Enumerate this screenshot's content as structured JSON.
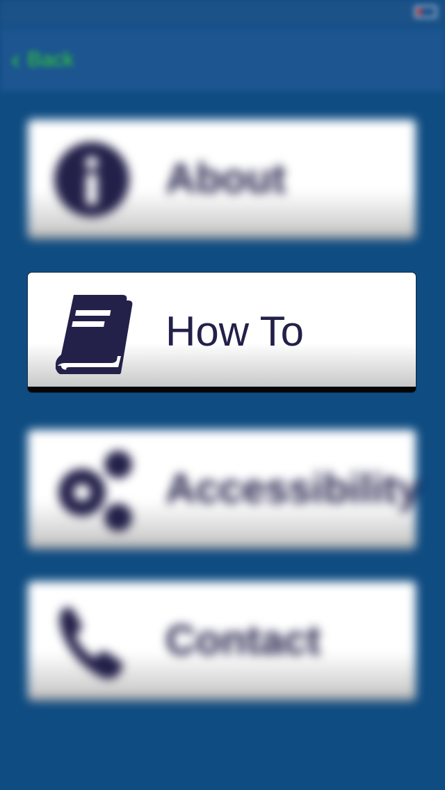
{
  "status_bar": {
    "carrier": "",
    "time": "",
    "battery": ""
  },
  "nav": {
    "back_label": "Back"
  },
  "menu": {
    "items": [
      {
        "label": "About",
        "icon": "info-icon"
      },
      {
        "label": "How To",
        "icon": "book-icon"
      },
      {
        "label": "Accessibility",
        "icon": "gears-icon"
      },
      {
        "label": "Contact",
        "icon": "phone-icon"
      }
    ]
  },
  "colors": {
    "background": "#0f4c82",
    "button_text": "#232049",
    "back_accent": "#33cc33"
  }
}
